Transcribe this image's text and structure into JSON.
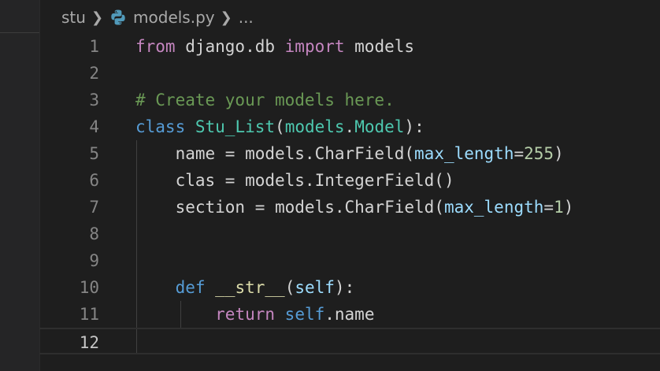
{
  "breadcrumb": {
    "folder": "stu",
    "file": "models.py",
    "ellipsis": "...",
    "file_icon": "python-icon"
  },
  "editor": {
    "current_line": 12,
    "lines": [
      {
        "num": "1",
        "tokens": [
          {
            "t": "from",
            "k": "kw"
          },
          {
            "t": " django.db ",
            "k": "txt"
          },
          {
            "t": "import",
            "k": "kw"
          },
          {
            "t": " models",
            "k": "txt"
          }
        ]
      },
      {
        "num": "2",
        "tokens": []
      },
      {
        "num": "3",
        "tokens": [
          {
            "t": "# Create your models here.",
            "k": "cmt"
          }
        ]
      },
      {
        "num": "4",
        "tokens": [
          {
            "t": "class",
            "k": "def"
          },
          {
            "t": " ",
            "k": "txt"
          },
          {
            "t": "Stu_List",
            "k": "cls"
          },
          {
            "t": "(",
            "k": "txt"
          },
          {
            "t": "models",
            "k": "cls"
          },
          {
            "t": ".",
            "k": "txt"
          },
          {
            "t": "Model",
            "k": "cls"
          },
          {
            "t": "):",
            "k": "txt"
          }
        ]
      },
      {
        "num": "5",
        "tokens": [
          {
            "t": "    name = models.",
            "k": "txt"
          },
          {
            "t": "CharField",
            "k": "txt"
          },
          {
            "t": "(",
            "k": "txt"
          },
          {
            "t": "max_length",
            "k": "param"
          },
          {
            "t": "=",
            "k": "txt"
          },
          {
            "t": "255",
            "k": "num"
          },
          {
            "t": ")",
            "k": "txt"
          }
        ]
      },
      {
        "num": "6",
        "tokens": [
          {
            "t": "    clas = models.",
            "k": "txt"
          },
          {
            "t": "IntegerField",
            "k": "txt"
          },
          {
            "t": "()",
            "k": "txt"
          }
        ]
      },
      {
        "num": "7",
        "tokens": [
          {
            "t": "    section = models.",
            "k": "txt"
          },
          {
            "t": "CharField",
            "k": "txt"
          },
          {
            "t": "(",
            "k": "txt"
          },
          {
            "t": "max_length",
            "k": "param"
          },
          {
            "t": "=",
            "k": "txt"
          },
          {
            "t": "1",
            "k": "num"
          },
          {
            "t": ")",
            "k": "txt"
          }
        ]
      },
      {
        "num": "8",
        "tokens": []
      },
      {
        "num": "9",
        "tokens": []
      },
      {
        "num": "10",
        "tokens": [
          {
            "t": "    ",
            "k": "txt"
          },
          {
            "t": "def",
            "k": "def"
          },
          {
            "t": " ",
            "k": "txt"
          },
          {
            "t": "__str__",
            "k": "fn"
          },
          {
            "t": "(",
            "k": "txt"
          },
          {
            "t": "self",
            "k": "param"
          },
          {
            "t": "):",
            "k": "txt"
          }
        ]
      },
      {
        "num": "11",
        "tokens": [
          {
            "t": "        ",
            "k": "txt"
          },
          {
            "t": "return",
            "k": "kw"
          },
          {
            "t": " ",
            "k": "txt"
          },
          {
            "t": "self",
            "k": "def"
          },
          {
            "t": ".name",
            "k": "txt"
          }
        ]
      },
      {
        "num": "12",
        "tokens": []
      }
    ]
  },
  "colors": {
    "background": "#1e1e1e",
    "keyword": "#c586c0",
    "storage": "#569cd6",
    "class": "#4ec9b0",
    "function": "#dcdcaa",
    "parameter": "#9cdcfe",
    "number": "#b5cea8",
    "comment": "#6a9955"
  }
}
